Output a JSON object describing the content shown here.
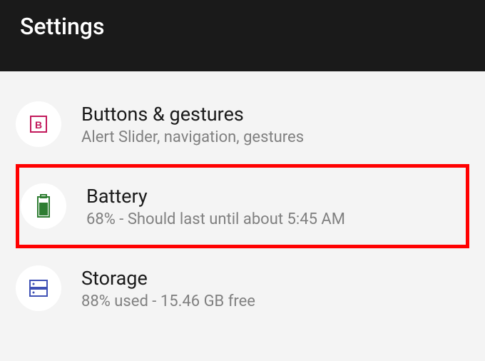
{
  "header": {
    "title": "Settings"
  },
  "items": [
    {
      "icon": "buttons-icon",
      "title": "Buttons & gestures",
      "subtitle": "Alert Slider, navigation, gestures"
    },
    {
      "icon": "battery-icon",
      "title": "Battery",
      "subtitle": "68% - Should last until about 5:45 AM"
    },
    {
      "icon": "storage-icon",
      "title": "Storage",
      "subtitle": "88% used - 15.46 GB free"
    }
  ]
}
